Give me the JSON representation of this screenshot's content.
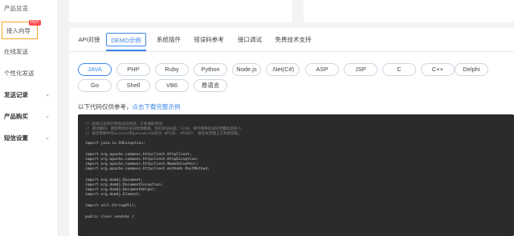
{
  "sidebar": {
    "items": [
      {
        "label": "产品总览"
      },
      {
        "label": "接入向导",
        "badge": "HOT"
      },
      {
        "label": "在线发送"
      },
      {
        "label": "个性化发送"
      },
      {
        "label": "发送记录"
      },
      {
        "label": "产品购买"
      },
      {
        "label": "短信设置"
      }
    ]
  },
  "tabs": [
    {
      "label": "API对接"
    },
    {
      "label": "DEMO示例",
      "active": true
    },
    {
      "label": "系统插件"
    },
    {
      "label": "错误码参考"
    },
    {
      "label": "接口调试"
    },
    {
      "label": "免费技术支持"
    }
  ],
  "languages": [
    {
      "label": "JAVA",
      "active": true
    },
    {
      "label": "PHP"
    },
    {
      "label": "Ruby"
    },
    {
      "label": "Python"
    },
    {
      "label": "Node.js"
    },
    {
      "label": ".Net(C#)"
    },
    {
      "label": "ASP"
    },
    {
      "label": "JSP"
    },
    {
      "label": "C"
    },
    {
      "label": "C++"
    },
    {
      "label": "Delphi"
    },
    {
      "label": "Go"
    },
    {
      "label": "Shell"
    },
    {
      "label": "VB6"
    },
    {
      "label": "易语言"
    }
  ],
  "reference": {
    "text": "以下代码仅供参考，",
    "link": "点击下载完整示例"
  },
  "code": [
    {
      "text": "// 此接口支持示例验证码测试，订单通知测试。",
      "comment": true
    },
    {
      "text": "// 调试期间，请使用测试号码给预模板，您的验证码是：1234，请不要把验证码泄露给其他人。",
      "comment": true
    },
    {
      "text": "// 请求参数中的account和password分别为 APIID, APIKEY, 请在本页面上方找到获取。",
      "comment": true
    },
    {
      "text": ""
    },
    {
      "text": "import java.io.IOException;"
    },
    {
      "text": ""
    },
    {
      "text": "import org.apache.commons.httpclient.HttpClient;"
    },
    {
      "text": "import org.apache.commons.httpclient.HttpException;"
    },
    {
      "text": "import org.apache.commons.httpclient.NameValuePair;"
    },
    {
      "text": "import org.apache.commons.httpclient.methods.PostMethod;"
    },
    {
      "text": ""
    },
    {
      "text": "import org.dom4j.Document;"
    },
    {
      "text": "import org.dom4j.DocumentException;"
    },
    {
      "text": "import org.dom4j.DocumentHelper;"
    },
    {
      "text": "import org.dom4j.Element;"
    },
    {
      "text": ""
    },
    {
      "text": "import util.StringUtil;"
    },
    {
      "text": ""
    },
    {
      "text": "public class sendsms {"
    }
  ]
}
